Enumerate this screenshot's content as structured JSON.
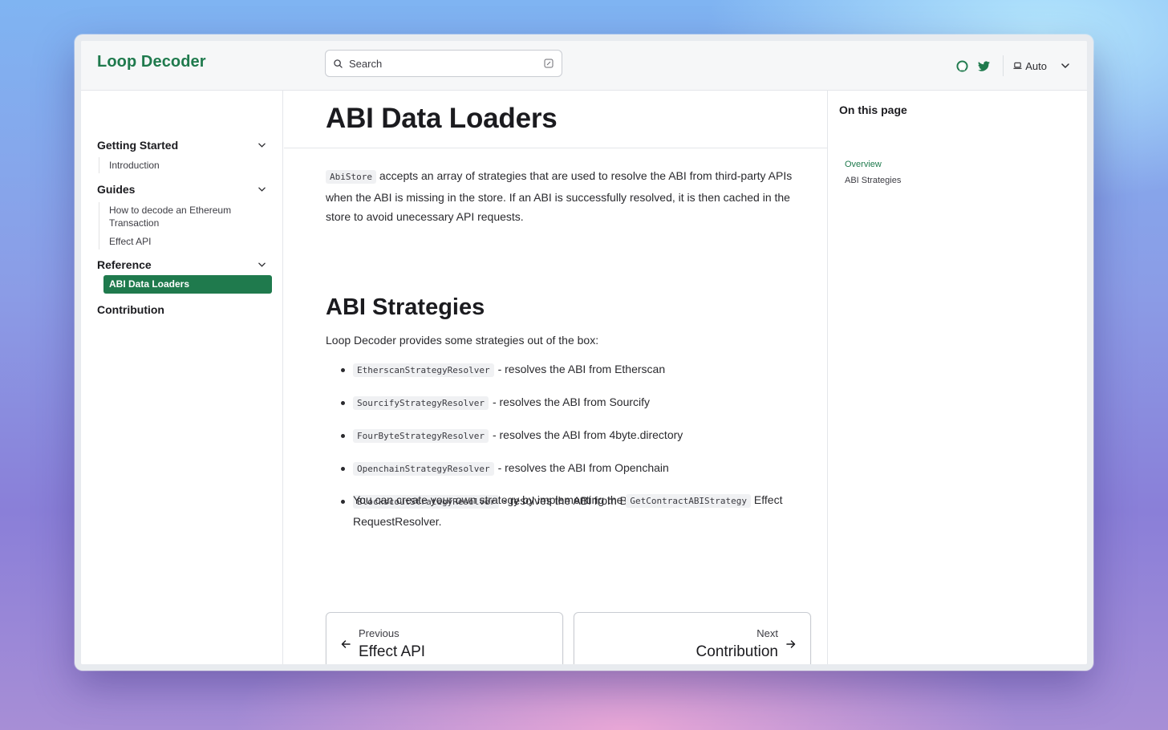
{
  "app": {
    "brand": "Loop Decoder",
    "brand_color": "#1f7a4d"
  },
  "search": {
    "placeholder": "Search",
    "icon": "search-icon",
    "shortcut_icon": "keyboard-shortcut-icon"
  },
  "header": {
    "github_icon": "github-icon",
    "twitter_icon": "twitter-icon",
    "theme_label": "Auto",
    "theme_icon": "laptop-icon"
  },
  "sidebar": {
    "sections": [
      {
        "title": "Getting Started",
        "items": [
          "Introduction"
        ]
      },
      {
        "title": "Guides",
        "items": [
          "How to decode an Ethereum Transaction",
          "Effect API"
        ]
      },
      {
        "title": "Reference",
        "items": [
          "ABI Data Loaders"
        ]
      },
      {
        "title": "Contribution",
        "items": []
      }
    ],
    "active_item": "ABI Data Loaders"
  },
  "main": {
    "title": "ABI Data Loaders",
    "intro_code": "AbiStore",
    "intro_text": " accepts an array of strategies that are used to resolve the ABI from third-party APIs when the ABI is missing in the store. If an ABI is successfully resolved, it is then cached in the store to avoid unecessary API requests.",
    "section_title": "ABI Strategies",
    "lead": "Loop Decoder provides some strategies out of the box:",
    "strategies": [
      {
        "code": "EtherscanStrategyResolver",
        "text": "- resolves the ABI from Etherscan"
      },
      {
        "code": "SourcifyStrategyResolver",
        "text": "- resolves the ABI from Sourcify"
      },
      {
        "code": "FourByteStrategyResolver",
        "text": "- resolves the ABI from 4byte.directory"
      },
      {
        "code": "OpenchainStrategyResolver",
        "text": "- resolves the ABI from Openchain"
      },
      {
        "code": "BlockscoutStrategyResolver",
        "text": "- resolves the ABI from Blockscout"
      }
    ],
    "custom_prefix": "You can create your own strategy by implementing the ",
    "custom_code": "GetContractABIStrategy",
    "custom_suffix": " Effect RequestResolver."
  },
  "pager": {
    "prev_label": "Previous",
    "prev_title": "Effect API",
    "next_label": "Next",
    "next_title": "Contribution"
  },
  "toc": {
    "title": "On this page",
    "links": [
      {
        "label": "Overview",
        "active": true
      },
      {
        "label": "ABI Strategies",
        "active": false
      }
    ],
    "active_color": "#1f7a4d"
  }
}
